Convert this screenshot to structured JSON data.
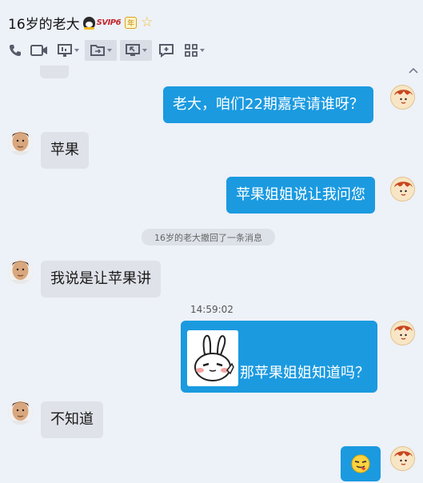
{
  "header": {
    "title": "16岁的老大",
    "svip_label": "SVIP6",
    "year_label": "年"
  },
  "toolbar": {
    "items": [
      "phone-icon",
      "video-call-icon",
      "screen-share-icon",
      "send-file-icon",
      "remote-desktop-icon",
      "new-discussion-icon",
      "apps-icon"
    ]
  },
  "system_message": "16岁的老大撤回了一条消息",
  "timestamp": "14:59:02",
  "messages": [
    {
      "from": "me",
      "text": "老大，咱们22期嘉宾请谁呀？"
    },
    {
      "from": "them",
      "text": "苹果"
    },
    {
      "from": "me",
      "text": "苹果姐姐说让我问您"
    },
    {
      "from": "them",
      "text": "我说是让苹果讲"
    },
    {
      "from": "me",
      "text": "那苹果姐姐知道吗？",
      "sticker": "bunny-sticker"
    },
    {
      "from": "them",
      "text": "不知道"
    },
    {
      "from": "me",
      "text": "",
      "emoji": "tongue-out-emoji"
    }
  ],
  "colors": {
    "background": "#edf1f8",
    "my_bubble": "#1b9ae0",
    "their_bubble": "#dfe2e8"
  }
}
